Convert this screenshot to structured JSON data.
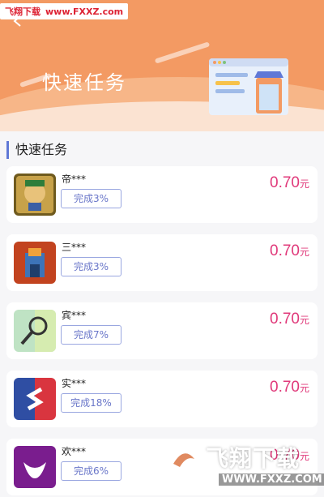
{
  "watermark_top": {
    "site": "飞翔下载",
    "url": "www.FXXZ.com"
  },
  "hero": {
    "title": "快速任务"
  },
  "section": {
    "title": "快速任务"
  },
  "tasks": [
    {
      "name": "帝***",
      "progress": "完成3%",
      "amount": "0.70",
      "unit": "元",
      "icon": "warrior-game-icon"
    },
    {
      "name": "三***",
      "progress": "完成3%",
      "amount": "0.70",
      "unit": "元",
      "icon": "castle-game-icon"
    },
    {
      "name": "宾***",
      "progress": "完成7%",
      "amount": "0.70",
      "unit": "元",
      "icon": "magnifier-app-icon"
    },
    {
      "name": "实***",
      "progress": "完成18%",
      "amount": "0.70",
      "unit": "元",
      "icon": "s-logo-app-icon"
    },
    {
      "name": "欢***",
      "progress": "完成6%",
      "amount": "0.70",
      "unit": "元",
      "icon": "purple-app-icon"
    }
  ],
  "watermark_bottom": {
    "site": "飞翔下载",
    "url": "WWW.FXXZ.COM"
  },
  "colors": {
    "hero": "#f39a63",
    "reward": "#e0397a",
    "progress_border": "#9aa7e0",
    "section_accent": "#5f78d6"
  }
}
